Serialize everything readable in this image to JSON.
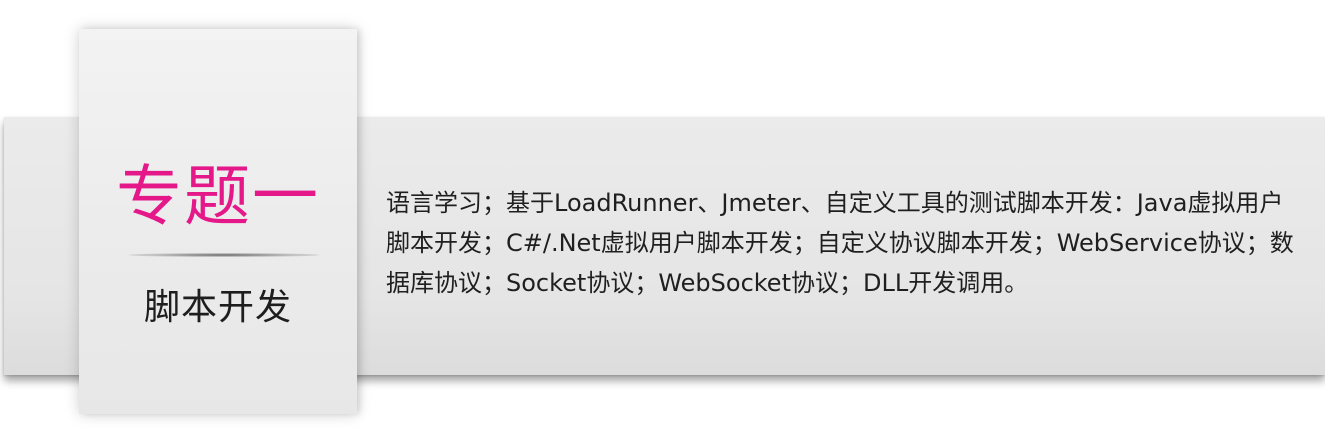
{
  "card": {
    "title": "专题一",
    "subtitle": "脚本开发"
  },
  "description": "语言学习；基于LoadRunner、Jmeter、自定义工具的测试脚本开发：Java虚拟用户脚本开发；C#/.Net虚拟用户脚本开发；自定义协议脚本开发；WebService协议；数据库协议；Socket协议；WebSocket协议；DLL开发调用。",
  "colors": {
    "title_accent": "#e5188a",
    "band_background": "#e6e6e6",
    "card_background": "#eeeeee",
    "text": "#1f1f1f"
  }
}
